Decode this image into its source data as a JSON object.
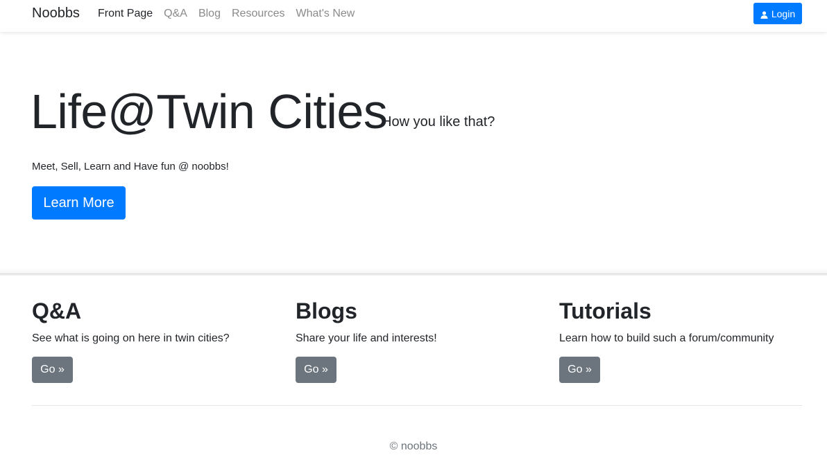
{
  "navbar": {
    "brand": "Noobbs",
    "links": [
      {
        "label": "Front Page",
        "active": true
      },
      {
        "label": "Q&A",
        "active": false
      },
      {
        "label": "Blog",
        "active": false
      },
      {
        "label": "Resources",
        "active": false
      },
      {
        "label": "What's New",
        "active": false
      }
    ],
    "login_label": "Login",
    "login_icon": "user-icon"
  },
  "hero": {
    "title": "Life@Twin Cities",
    "subtitle": "How you like that?",
    "lead": "Meet, Sell, Learn and Have fun @ noobbs!",
    "button_label": "Learn More"
  },
  "sections": [
    {
      "heading": "Q&A",
      "text": "See what is going on here in twin cities?",
      "button_label": "Go »"
    },
    {
      "heading": "Blogs",
      "text": "Share your life and interests!",
      "button_label": "Go »"
    },
    {
      "heading": "Tutorials",
      "text": "Learn how to build such a forum/community",
      "button_label": "Go »"
    }
  ],
  "footer": {
    "text": "© noobbs"
  },
  "colors": {
    "primary": "#007bff",
    "secondary": "#6c757d",
    "text": "#212529",
    "muted_link": "#8a8a8a"
  }
}
